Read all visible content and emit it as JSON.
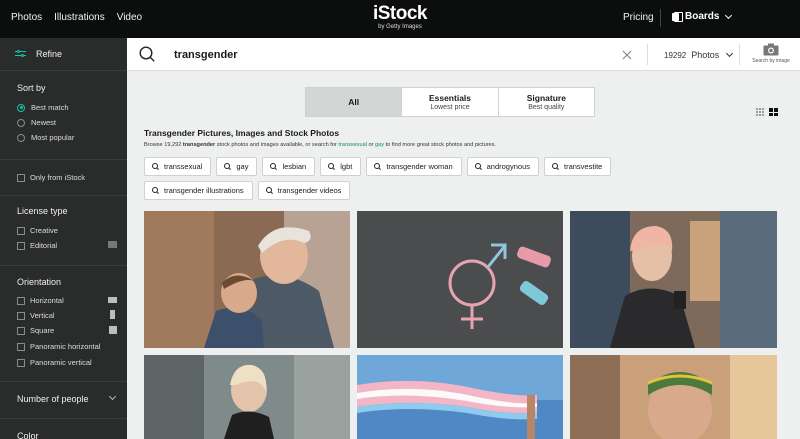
{
  "topbar": {
    "nav": [
      "Photos",
      "Illustrations",
      "Video"
    ],
    "logo": "iStock",
    "logo_sub": "by Getty Images",
    "pricing": "Pricing",
    "boards": "Boards"
  },
  "sidebar": {
    "refine": "Refine",
    "sort_by": {
      "title": "Sort by",
      "options": [
        "Best match",
        "Newest",
        "Most popular"
      ],
      "selected": "Best match"
    },
    "only_istock": "Only from iStock",
    "license_type": {
      "title": "License type",
      "options": [
        "Creative",
        "Editorial"
      ]
    },
    "orientation": {
      "title": "Orientation",
      "options": [
        "Horizontal",
        "Vertical",
        "Square",
        "Panoramic horizontal",
        "Panoramic vertical"
      ]
    },
    "number_of_people": "Number of people",
    "color": "Color"
  },
  "search": {
    "query": "transgender",
    "count": "19292",
    "media_type": "Photos",
    "search_by_image": "Search by image"
  },
  "tabs": [
    {
      "name": "All",
      "sub": ""
    },
    {
      "name": "Essentials",
      "sub": "Lowest price"
    },
    {
      "name": "Signature",
      "sub": "Best quality"
    }
  ],
  "results": {
    "title": "Transgender Pictures, Images and Stock Photos",
    "sub_prefix": "Browse 19,292 ",
    "sub_bold": "transgender",
    "sub_middle": " stock photos and images available, or search for ",
    "sub_link1": "transsexual",
    "sub_or": " or ",
    "sub_link2": "gay",
    "sub_suffix": " to find more great stock photos and pictures."
  },
  "chips": [
    "transsexual",
    "gay",
    "lesbian",
    "lgbt",
    "transgender woman",
    "androgynous",
    "transvestite",
    "transgender illustrations",
    "transgender videos"
  ],
  "colors": {
    "accent": "#18c3a8",
    "topbar": "#0c0d0d",
    "sidebar": "#2a2b2b",
    "link": "#0a8a76"
  }
}
